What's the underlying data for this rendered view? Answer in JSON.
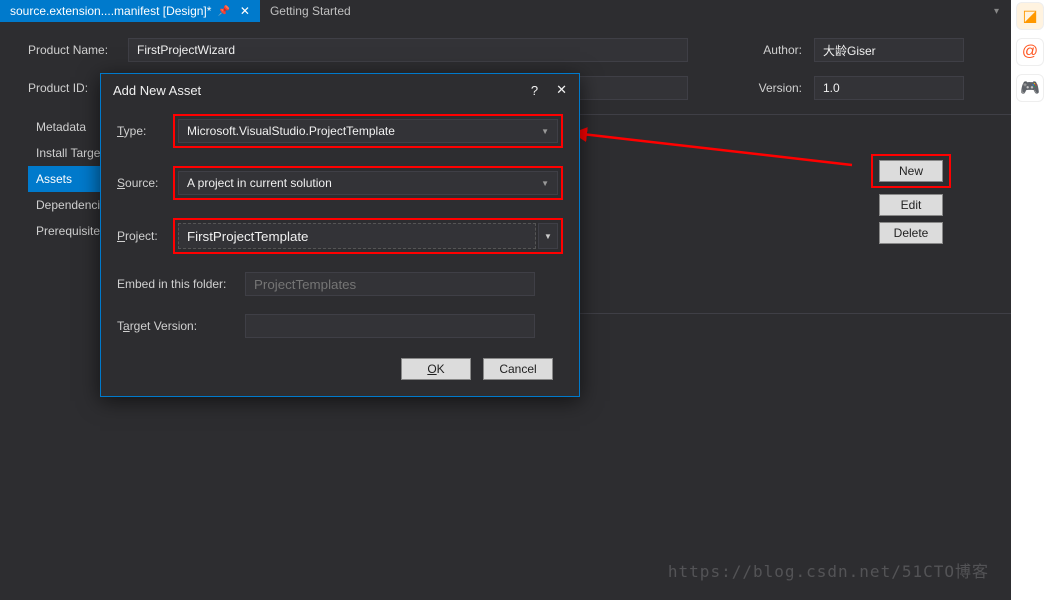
{
  "tabs": {
    "active": "source.extension....manifest [Design]*",
    "other": "Getting Started"
  },
  "form": {
    "product_name_label": "Product Name:",
    "product_name_value": "FirstProjectWizard",
    "product_id_label": "Product ID:",
    "author_label": "Author:",
    "author_value": "大龄Giser",
    "version_label": "Version:",
    "version_value": "1.0"
  },
  "sidebar": {
    "items": [
      {
        "label": "Metadata"
      },
      {
        "label": "Install Targets"
      },
      {
        "label": "Assets"
      },
      {
        "label": "Dependencies"
      },
      {
        "label": "Prerequisites"
      }
    ],
    "active_index": 2
  },
  "buttons": {
    "new": "New",
    "edit": "Edit",
    "delete": "Delete"
  },
  "dialog": {
    "title": "Add New Asset",
    "help": "?",
    "close": "✕",
    "type_label": "Type:",
    "type_value": "Microsoft.VisualStudio.ProjectTemplate",
    "source_label": "Source:",
    "source_value": "A project in current solution",
    "project_label": "Project:",
    "project_value": "FirstProjectTemplate",
    "embed_label": "Embed in this folder:",
    "embed_placeholder": "ProjectTemplates",
    "target_label": "Target Version:",
    "ok": "OK",
    "cancel": "Cancel"
  },
  "watermark": "https://blog.csdn.net/51CTO博客"
}
